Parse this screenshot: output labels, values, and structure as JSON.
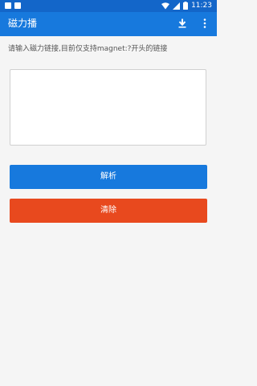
{
  "status_bar": {
    "time": "11:23",
    "left_icons": [
      "notification-icon",
      "sim-icon"
    ],
    "right_icons": [
      "wifi-icon",
      "signal-icon",
      "battery-icon"
    ]
  },
  "app_bar": {
    "title": "磁力播",
    "actions": [
      "download-icon",
      "more-vert-icon"
    ]
  },
  "hint": "请输入磁力链接,目前仅支持magnet:?开头的链接",
  "input": {
    "value": "",
    "placeholder": ""
  },
  "buttons": {
    "parse_label": "解析",
    "clear_label": "清除"
  },
  "colors": {
    "status_bar": "#1366c9",
    "app_bar": "#1779dd",
    "parse_button": "#1779dd",
    "clear_button": "#e8491e",
    "background": "#f5f5f5"
  }
}
